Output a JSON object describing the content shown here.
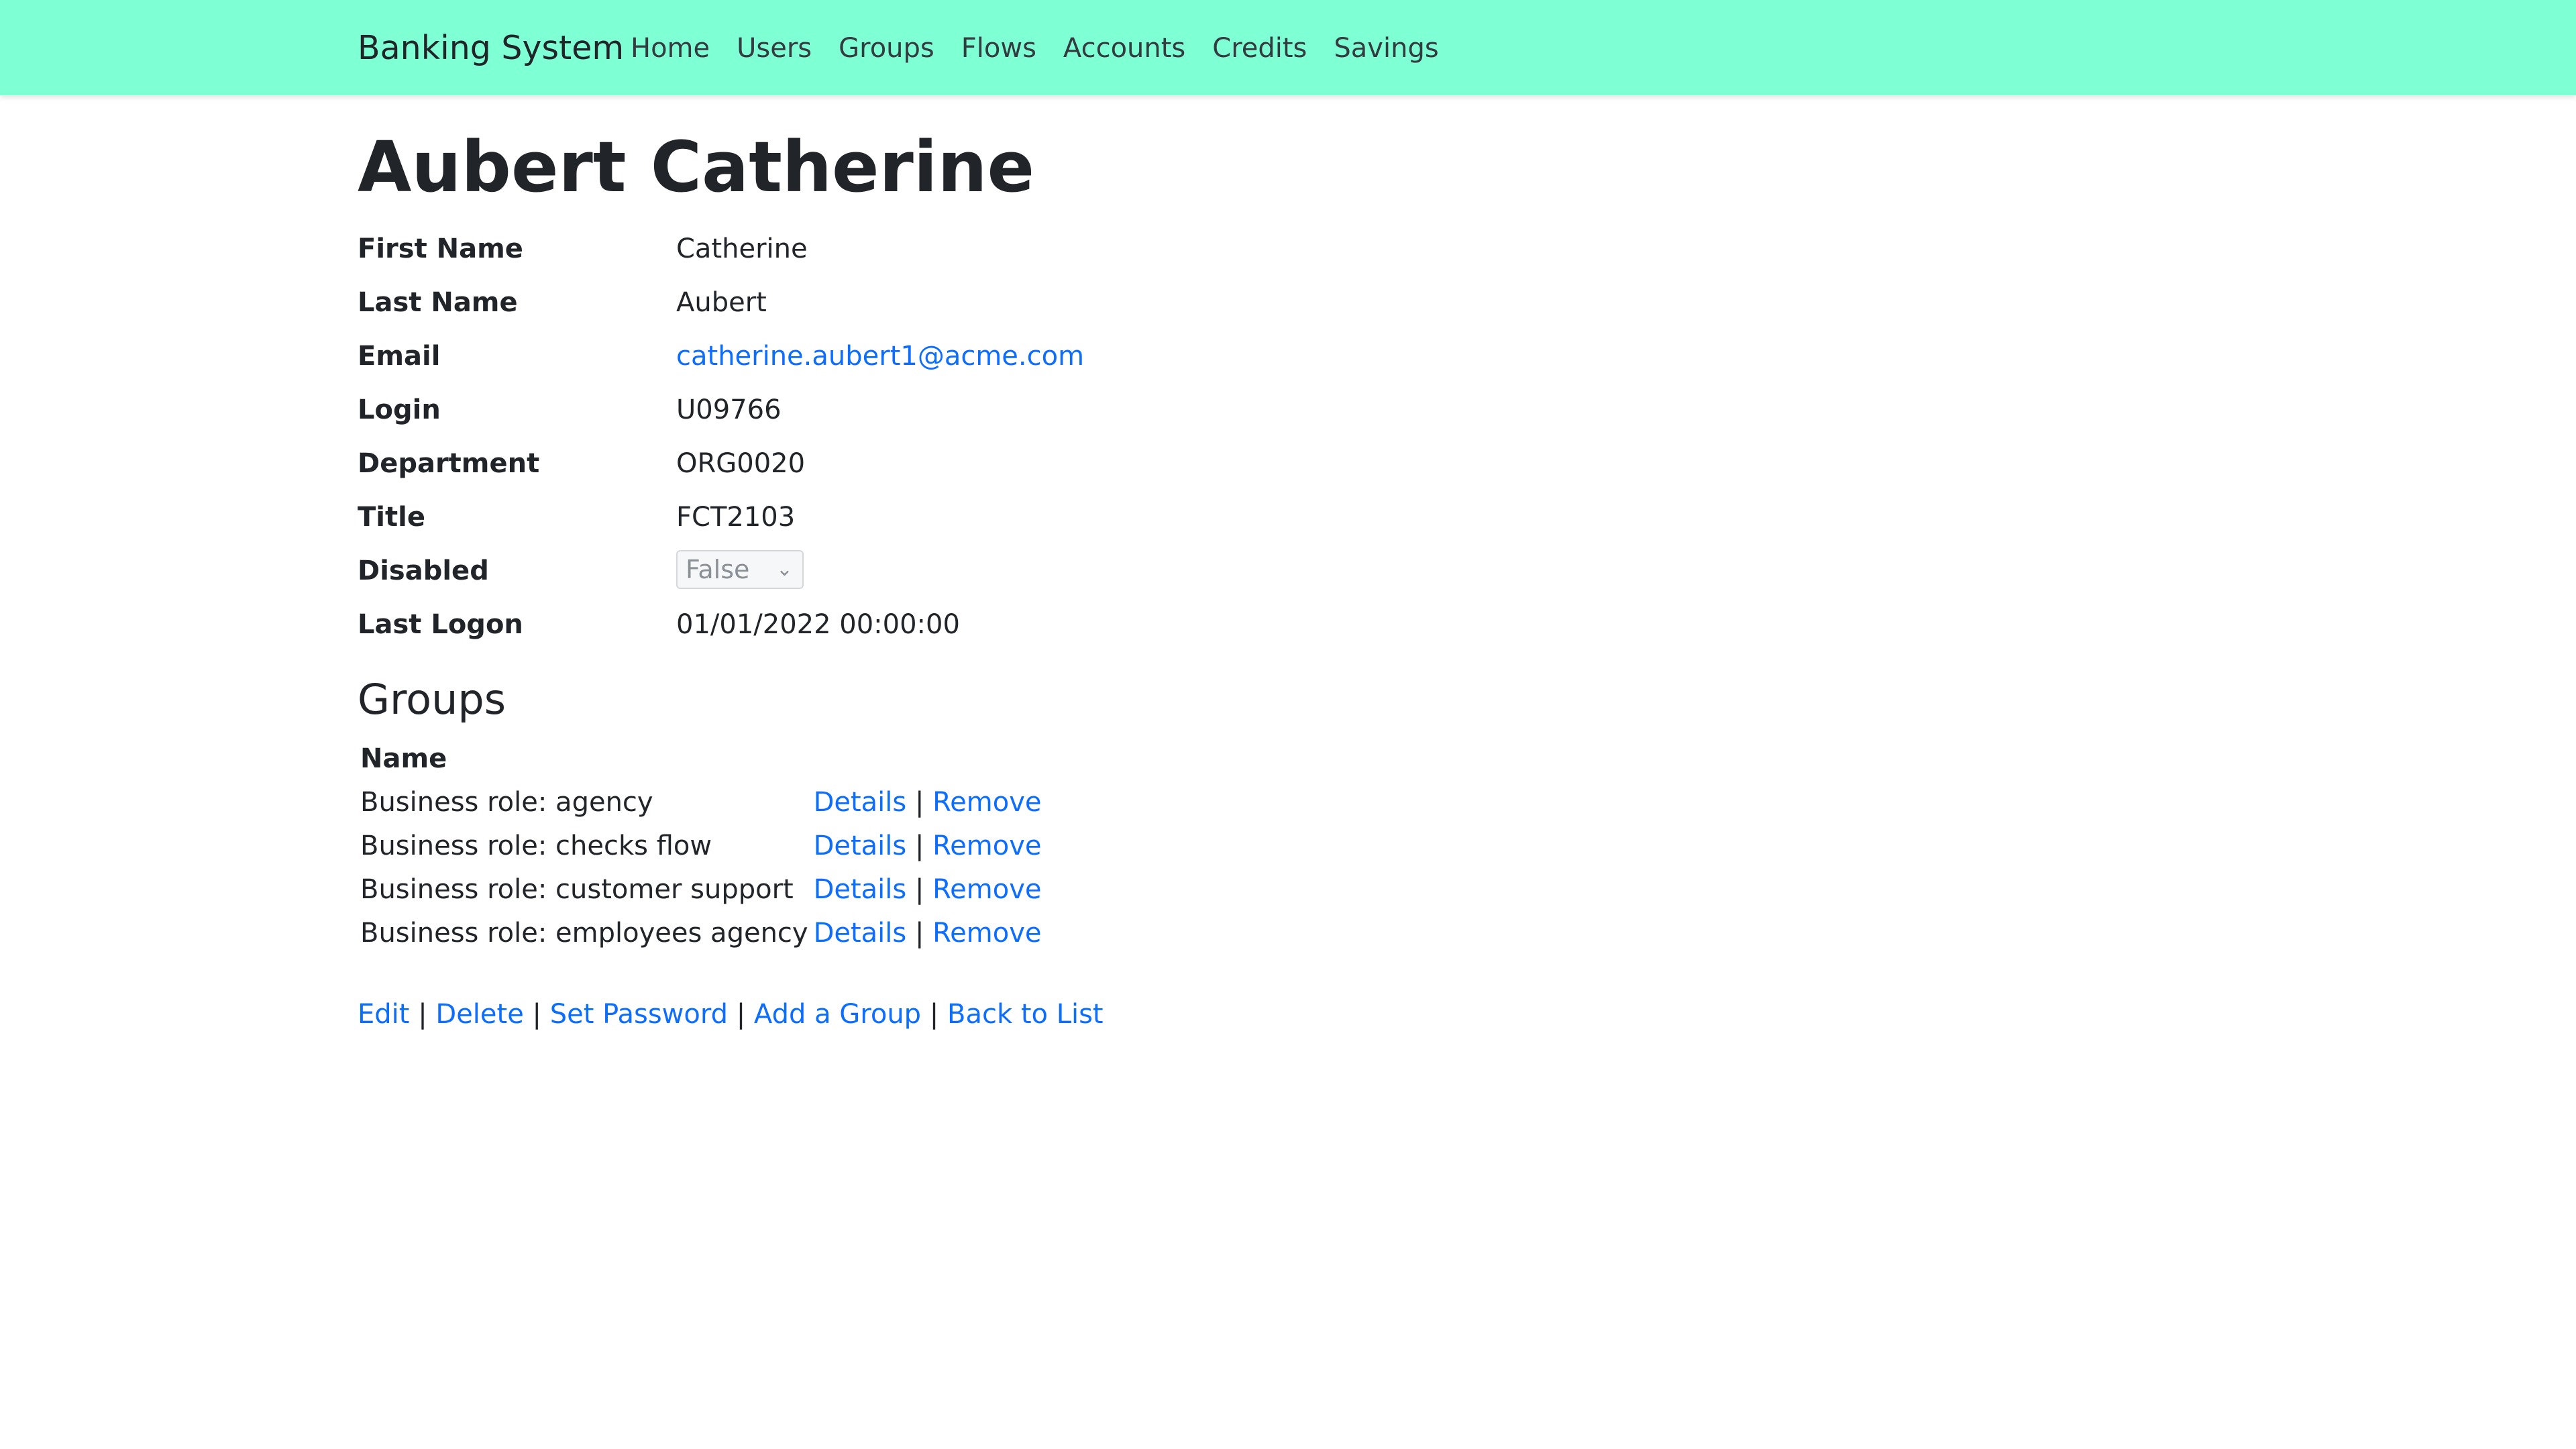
{
  "nav": {
    "brand": "Banking System",
    "items": [
      "Home",
      "Users",
      "Groups",
      "Flows",
      "Accounts",
      "Credits",
      "Savings"
    ]
  },
  "user": {
    "title": "Aubert Catherine",
    "fields": {
      "first_name": {
        "label": "First Name",
        "value": "Catherine"
      },
      "last_name": {
        "label": "Last Name",
        "value": "Aubert"
      },
      "email": {
        "label": "Email",
        "value": "catherine.aubert1@acme.com"
      },
      "login": {
        "label": "Login",
        "value": "U09766"
      },
      "department": {
        "label": "Department",
        "value": "ORG0020"
      },
      "title": {
        "label": "Title",
        "value": "FCT2103"
      },
      "disabled": {
        "label": "Disabled",
        "value": "False"
      },
      "last_logon": {
        "label": "Last Logon",
        "value": "01/01/2022 00:00:00"
      }
    }
  },
  "groups": {
    "heading": "Groups",
    "column_name": "Name",
    "details_label": "Details",
    "remove_label": "Remove",
    "separator": "|",
    "rows": [
      "Business role: agency",
      "Business role: checks flow",
      "Business role: customer support",
      "Business role: employees agency"
    ]
  },
  "actions": {
    "edit": "Edit",
    "delete": "Delete",
    "set_password": "Set Password",
    "add_group": "Add a Group",
    "back_to_list": "Back to List",
    "separator": "|"
  },
  "colors": {
    "navbar": "#7fffd4",
    "link": "#0d6efd"
  }
}
